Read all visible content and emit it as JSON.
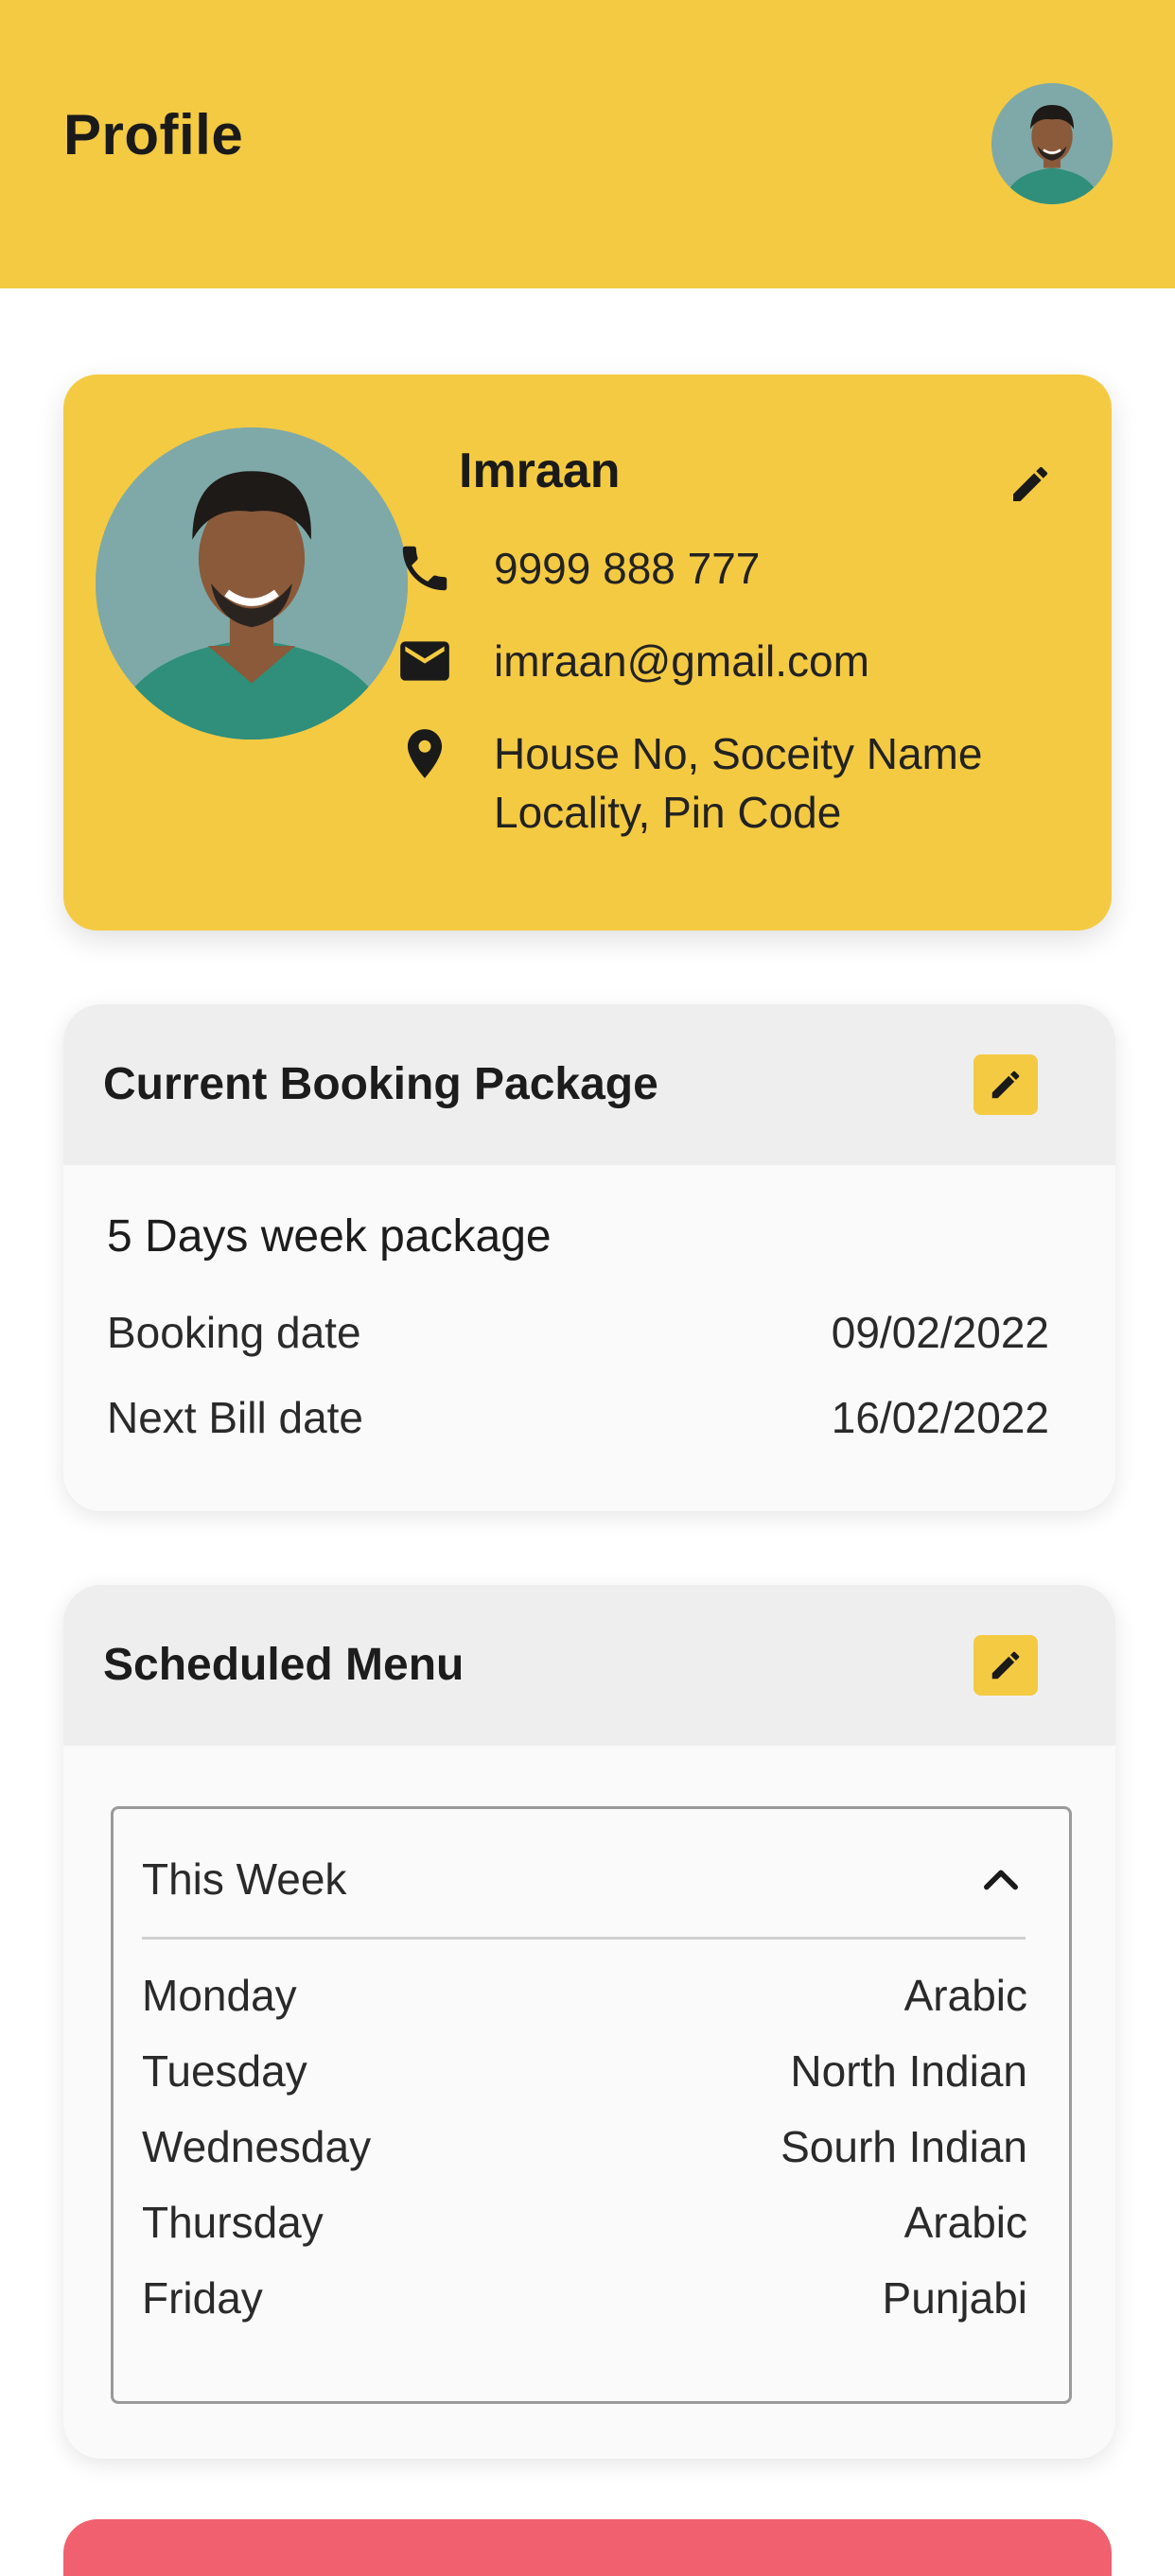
{
  "header": {
    "title": "Profile"
  },
  "profile": {
    "name": "Imraan",
    "phone": "9999 888 777",
    "email": "imraan@gmail.com",
    "address_line1": "House No, Soceity Name",
    "address_line2": "Locality, Pin Code"
  },
  "booking": {
    "title": "Current Booking Package",
    "package": "5 Days week package",
    "rows": [
      {
        "label": "Booking date",
        "value": "09/02/2022"
      },
      {
        "label": "Next Bill date",
        "value": "16/02/2022"
      }
    ]
  },
  "menu": {
    "title": "Scheduled Menu",
    "period": "This Week",
    "days": [
      {
        "day": "Monday",
        "cuisine": "Arabic"
      },
      {
        "day": "Tuesday",
        "cuisine": "North Indian"
      },
      {
        "day": "Wednesday",
        "cuisine": "Sourh Indian"
      },
      {
        "day": "Thursday",
        "cuisine": "Arabic"
      },
      {
        "day": "Friday",
        "cuisine": "Punjabi"
      }
    ]
  },
  "colors": {
    "accent": "#f4ca42",
    "card_bg": "#fafafa",
    "card_head_bg": "#eeeeee",
    "next_card": "#f0606e"
  },
  "icons": [
    "avatar",
    "edit-icon",
    "phone-icon",
    "email-icon",
    "location-icon",
    "chevron-up-icon"
  ]
}
